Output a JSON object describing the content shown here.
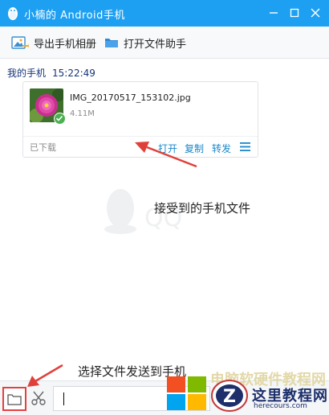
{
  "window": {
    "title": "小楠的 Android手机",
    "accent": "#1ea0f2"
  },
  "toolbar": {
    "export_label": "导出手机相册",
    "assistant_label": "打开文件助手"
  },
  "message": {
    "sender": "我的手机",
    "time": "15:22:49",
    "file": {
      "name": "IMG_20170517_153102.jpg",
      "size": "4.11M",
      "status": "已下载",
      "actions": {
        "open": "打开",
        "copy": "复制",
        "forward": "转发"
      }
    }
  },
  "annotations": {
    "received": "接受到的手机文件",
    "send": "选择文件发送到手机",
    "color": "#e0403a"
  },
  "logo": {
    "site_name": "这里教程网",
    "url": "herecours.com",
    "faded_text": "电脑软硬件教程网"
  },
  "icons": {
    "app": "qq-penguin-icon",
    "export": "photo-export-icon",
    "assistant": "folder-icon",
    "more": "menu-icon",
    "folder": "folder-icon",
    "screenshot": "scissors-icon"
  }
}
